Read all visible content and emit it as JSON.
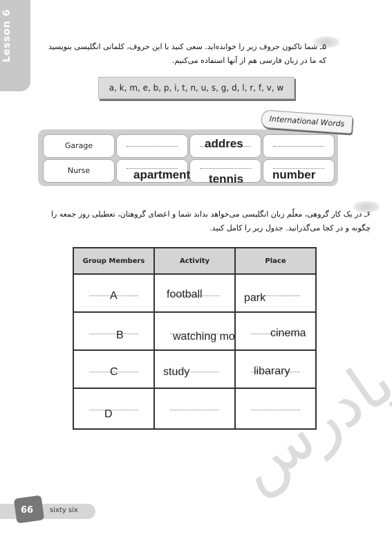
{
  "lesson_label": "Lesson 6",
  "exercise5": {
    "instruction": "۵ـ شما تاکنون حروف زیر را خوانده‌اید. سعی کنید با این حروف، کلماتی انگلیسی بنویسید که ما در زبان فارسی هم از آنها استفاده می‌کنیم.",
    "letters": "a, k, m, e, b, p, i, t, n, u, s, g, d,  l, r, f, v, w",
    "tag": "International Words",
    "words": [
      "Garage",
      "",
      "",
      "",
      "Nurse",
      "",
      "",
      ""
    ],
    "answers": [
      "addres",
      "apartment",
      "tennis",
      "number"
    ]
  },
  "exercise6": {
    "instruction": "۶ـ در یک کار گروهی، معلّم زبان انگلیسی می‌خواهد بداند شما و اعضای گروهتان، تعطیلی روز جمعه را چگونه و در کجا می‌گذرانید. جدول زیر را کامل کنید.",
    "headers": [
      "Group Members",
      "Activity",
      "Place"
    ],
    "rows": [
      [
        "A",
        "football",
        "park"
      ],
      [
        "B",
        "watching movie",
        "cinema"
      ],
      [
        "C",
        "study",
        "libarary"
      ],
      [
        "D",
        "",
        ""
      ]
    ]
  },
  "watermark_logo": "پادرس",
  "footer": {
    "page_number": "66",
    "page_words": "sixty six"
  }
}
